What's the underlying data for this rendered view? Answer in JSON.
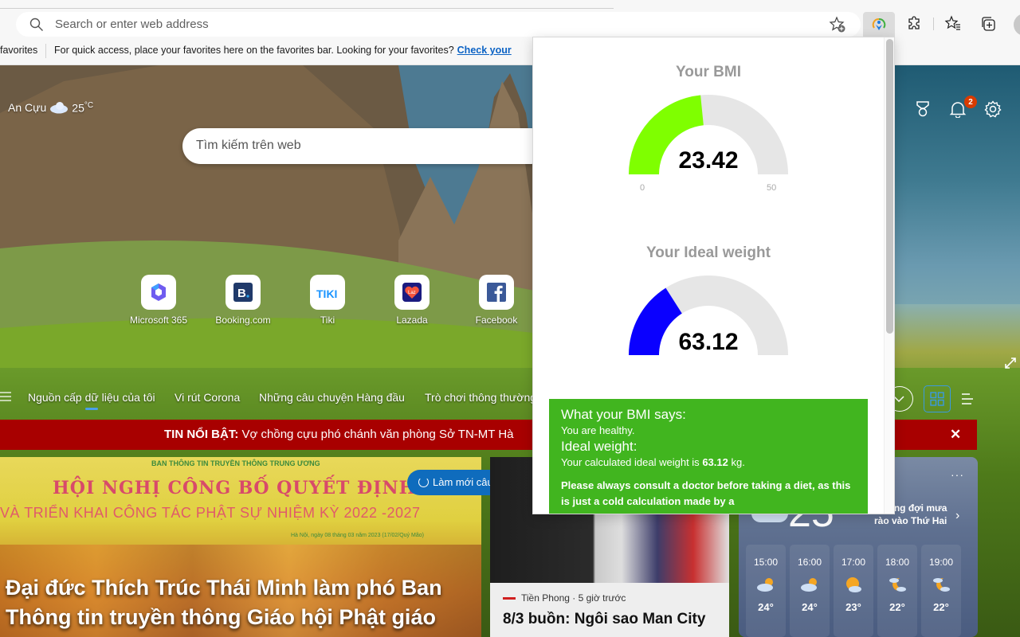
{
  "browser": {
    "address_placeholder": "Search or enter web address",
    "favorites_bar": {
      "left_label": "favorites",
      "message": "For quick access, place your favorites here on the favorites bar. Looking for your favorites?",
      "link": "Check your"
    },
    "toolbar_icons": [
      "add-favorite-icon",
      "bmi-extension-icon",
      "extensions-icon",
      "favorites-icon",
      "collections-icon",
      "profile-avatar"
    ]
  },
  "newtab": {
    "location": "An Cựu",
    "temperature": "25",
    "temp_unit": "°C",
    "search_placeholder": "Tìm kiếm trên web",
    "quick_links": [
      {
        "label": "Microsoft 365",
        "icon": "microsoft365-icon"
      },
      {
        "label": "Booking.com",
        "icon": "booking-icon"
      },
      {
        "label": "Tiki",
        "icon": "tiki-icon"
      },
      {
        "label": "Lazada",
        "icon": "lazada-icon"
      },
      {
        "label": "Facebook",
        "icon": "facebook-icon"
      }
    ],
    "notification_count": "2",
    "feed_tabs": [
      "Nguồn cấp dữ liệu của tôi",
      "Vi rút Corona",
      "Những câu chuyện Hàng đầu",
      "Trò chơi thông thường"
    ],
    "breaking": {
      "label": "TIN NỔI BẬT:",
      "text": "Vợ chồng cựu phó chánh văn phòng Sở TN-MT Hà"
    },
    "refresh_label": "Làm mới câu chuyện",
    "hero": {
      "banner_top": "BAN THÔNG TIN TRUYỀN THÔNG TRUNG ƯƠNG",
      "banner_line1": "HỘI NGHỊ CÔNG BỐ QUYẾT ĐỊNH NHÂN SỰ",
      "banner_line2": "VÀ TRIỂN KHAI CÔNG TÁC PHẬT SỰ NHIỆM KỲ 2022 -2027",
      "banner_date": "Hà Nội, ngày 08 tháng 03 năm 2023 (17/02/Quý Mão)",
      "title": "Đại đức Thích Trúc Thái Minh làm phó Ban Thông tin truyền thông Giáo hội Phật giáo"
    },
    "card2": {
      "source": "Tiền Phong · 5 giờ trước",
      "headline": "8/3 buồn: Ngôi sao Man City"
    },
    "weather_card": {
      "current_temp": "25",
      "forecast_msg_line1": "ng đợi mưa",
      "forecast_msg_line2": "rào vào Thứ Hai",
      "more": "···",
      "hours": [
        {
          "time": "15:00",
          "temp": "24°",
          "icon": "partly-cloudy-day-icon"
        },
        {
          "time": "16:00",
          "temp": "24°",
          "icon": "partly-cloudy-day-icon"
        },
        {
          "time": "17:00",
          "temp": "23°",
          "icon": "mostly-sunny-icon"
        },
        {
          "time": "18:00",
          "temp": "22°",
          "icon": "partly-cloudy-night-icon"
        },
        {
          "time": "19:00",
          "temp": "22°",
          "icon": "partly-cloudy-night-icon"
        }
      ]
    }
  },
  "bmi_popup": {
    "bmi": {
      "title": "Your BMI",
      "value": "23.42",
      "numeric": 23.42,
      "min": "0",
      "max": "50",
      "min_num": 0,
      "max_num": 50,
      "color": "#7fff00"
    },
    "ideal": {
      "title": "Your Ideal weight",
      "value": "63.12",
      "fill_fraction": 0.32,
      "color": "#0a00ff"
    },
    "result": {
      "heading1": "What your BMI says:",
      "text1": "You are healthy.",
      "heading2": "Ideal weight:",
      "text2_prefix": "Your calculated ideal weight is",
      "text2_value": "63.12",
      "text2_suffix": "kg.",
      "warning": "Please always consult a doctor before taking a diet, as this is just a cold calculation made by a"
    }
  }
}
